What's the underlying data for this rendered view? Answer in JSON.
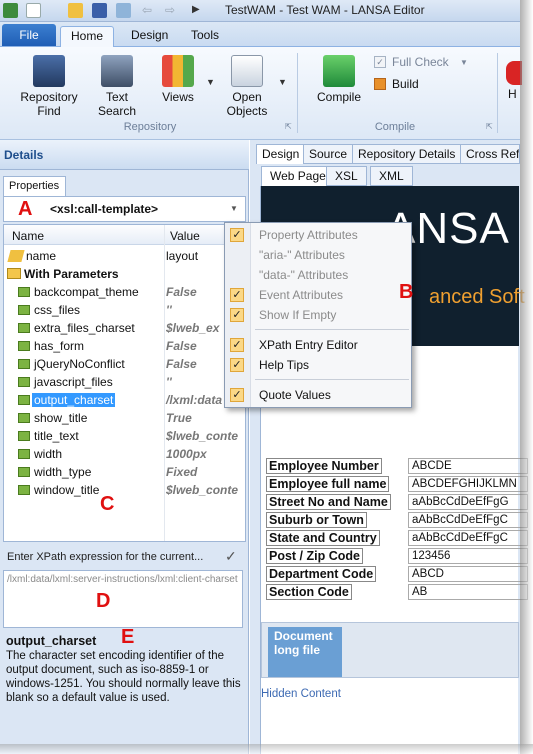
{
  "app": {
    "title": "TestWAM - Test WAM - LANSA Editor"
  },
  "tabs": {
    "file": "File",
    "home": "Home",
    "design": "Design",
    "tools": "Tools"
  },
  "ribbon": {
    "repository_find": [
      "Repository",
      "Find"
    ],
    "text_search": "Text Search",
    "views": "Views",
    "open_objects": [
      "Open",
      "Objects"
    ],
    "repository_group": "Repository",
    "compile": "Compile",
    "full_check": "Full Check",
    "build": "Build",
    "compile_group": "Compile",
    "help_partial": "H"
  },
  "left": {
    "details_title": "Details",
    "properties_tab": "Properties",
    "selected_element": "<xsl:call-template>",
    "columns": {
      "name": "Name",
      "value": "Value"
    },
    "name_row": {
      "name": "name",
      "value": "layout"
    },
    "params_group": "With Parameters",
    "params": [
      {
        "name": "backcompat_theme",
        "value": "False"
      },
      {
        "name": "css_files",
        "value": "''"
      },
      {
        "name": "extra_files_charset",
        "value": "$lweb_ex"
      },
      {
        "name": "has_form",
        "value": "False"
      },
      {
        "name": "jQueryNoConflict",
        "value": "False"
      },
      {
        "name": "javascript_files",
        "value": "''"
      },
      {
        "name": "output_charset",
        "value": "/lxml:data"
      },
      {
        "name": "show_title",
        "value": "True"
      },
      {
        "name": "title_text",
        "value": "$lweb_conte"
      },
      {
        "name": "width",
        "value": "1000px"
      },
      {
        "name": "width_type",
        "value": "Fixed"
      },
      {
        "name": "window_title",
        "value": "$lweb_conte"
      }
    ],
    "xpath_header": "Enter XPath expression for the current...",
    "xpath_value": "/lxml:data/lxml:server-instructions/lxml:client-charset",
    "help_title": "output_charset",
    "help_text": "The character set encoding identifier of the output document, such as iso-8859-1 or windows-1251. You should normally leave this blank so a default value is used."
  },
  "labels": {
    "a": "A",
    "b": "B",
    "c": "C",
    "d": "D",
    "e": "E"
  },
  "right": {
    "doc_tabs": [
      "Design",
      "Source",
      "Repository Details",
      "Cross Refe"
    ],
    "sub_tabs": [
      "Web Page",
      "XSL",
      "XML"
    ],
    "banner_text": "ANSA",
    "banner_sub": "anced Soft",
    "fields": [
      {
        "label": "Employee Number",
        "value": "ABCDE"
      },
      {
        "label": "Employee full name",
        "value": "ABCDEFGHIJKLMN"
      },
      {
        "label": "Street No and Name",
        "value": "aAbBcCdDeEfFgG"
      },
      {
        "label": "Suburb or Town",
        "value": "aAbBcCdDeEfFgC"
      },
      {
        "label": "State and Country",
        "value": "aAbBcCdDeEfFgC"
      },
      {
        "label": "Post / Zip Code",
        "value": "123456"
      },
      {
        "label": "Department Code",
        "value": "ABCD"
      },
      {
        "label": "Section Code",
        "value": "AB"
      }
    ],
    "doc_column": "Document long file",
    "hidden_content": "Hidden Content"
  },
  "menu": {
    "items": [
      {
        "label": "Property Attributes",
        "checked": true,
        "disabled": true
      },
      {
        "label": "\"aria-\" Attributes",
        "checked": false,
        "disabled": true
      },
      {
        "label": "\"data-\" Attributes",
        "checked": false,
        "disabled": true
      },
      {
        "label": "Event Attributes",
        "checked": true,
        "disabled": true
      },
      {
        "label": "Show If Empty",
        "checked": true,
        "disabled": true
      },
      {
        "label": "XPath Entry Editor",
        "checked": true,
        "disabled": false
      },
      {
        "label": "Help Tips",
        "checked": true,
        "disabled": false
      },
      {
        "label": "Quote Values",
        "checked": true,
        "disabled": false
      }
    ]
  },
  "colors": {
    "accent": "#1f5eb5",
    "selection": "#3399ff",
    "annotation": "#e01010",
    "checked_bg": "#fbd886"
  }
}
